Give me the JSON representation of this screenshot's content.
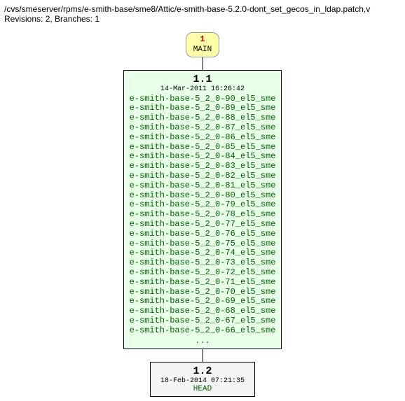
{
  "header": {
    "path": "/cvs/smeserver/rpms/e-smith-base/sme8/Attic/e-smith-base-5.2.0-dont_set_gecos_in_ldap.patch,v",
    "revisions_line": "Revisions: 2, Branches: 1"
  },
  "main_bubble": {
    "num": "1",
    "label": "MAIN"
  },
  "node_1_1": {
    "version": "1.1",
    "timestamp": "14-Mar-2011 16:26:42",
    "tags": [
      "e-smith-base-5_2_0-90_el5_sme",
      "e-smith-base-5_2_0-89_el5_sme",
      "e-smith-base-5_2_0-88_el5_sme",
      "e-smith-base-5_2_0-87_el5_sme",
      "e-smith-base-5_2_0-86_el5_sme",
      "e-smith-base-5_2_0-85_el5_sme",
      "e-smith-base-5_2_0-84_el5_sme",
      "e-smith-base-5_2_0-83_el5_sme",
      "e-smith-base-5_2_0-82_el5_sme",
      "e-smith-base-5_2_0-81_el5_sme",
      "e-smith-base-5_2_0-80_el5_sme",
      "e-smith-base-5_2_0-79_el5_sme",
      "e-smith-base-5_2_0-78_el5_sme",
      "e-smith-base-5_2_0-77_el5_sme",
      "e-smith-base-5_2_0-76_el5_sme",
      "e-smith-base-5_2_0-75_el5_sme",
      "e-smith-base-5_2_0-74_el5_sme",
      "e-smith-base-5_2_0-73_el5_sme",
      "e-smith-base-5_2_0-72_el5_sme",
      "e-smith-base-5_2_0-71_el5_sme",
      "e-smith-base-5_2_0-70_el5_sme",
      "e-smith-base-5_2_0-69_el5_sme",
      "e-smith-base-5_2_0-68_el5_sme",
      "e-smith-base-5_2_0-67_el5_sme",
      "e-smith-base-5_2_0-66_el5_sme"
    ],
    "more": "..."
  },
  "node_1_2": {
    "version": "1.2",
    "timestamp": "18-Feb-2014 07:21:35",
    "head": "HEAD"
  }
}
